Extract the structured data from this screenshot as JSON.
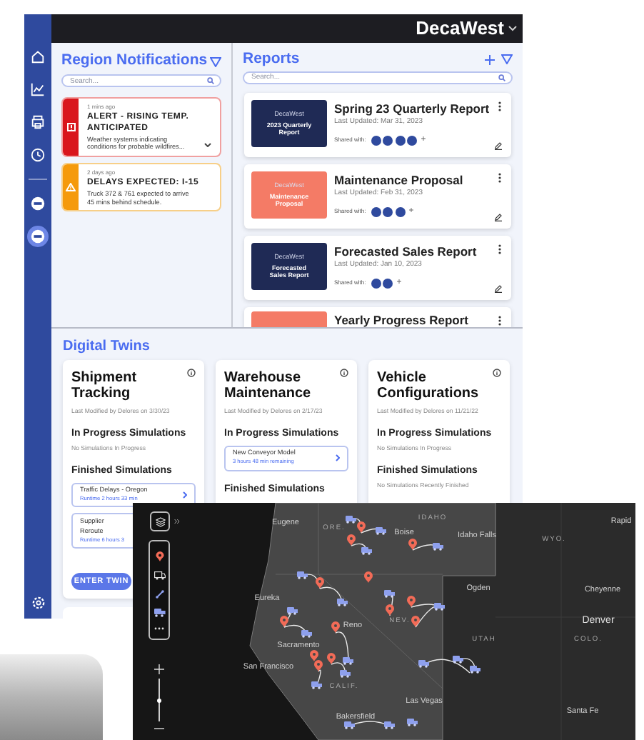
{
  "app_bar": {
    "brand": "DecaWest"
  },
  "sidebar": {
    "nav_items": [
      {
        "selected": false
      },
      {
        "selected": false
      },
      {
        "selected": false
      },
      {
        "selected": false
      },
      {
        "selected": false
      },
      {
        "selected": true
      }
    ]
  },
  "notifications": {
    "title": "Region Notifications",
    "search": {
      "placeholder": "Search..."
    },
    "items": [
      {
        "kind": "alert",
        "time": "1 mins ago",
        "title": "ALERT - RISING TEMP. ANTICIPATED",
        "body": "Weather systems indicating conditions for probable wildfires...",
        "expanded": false
      },
      {
        "kind": "warning",
        "time": "2 days ago",
        "title": "DELAYS EXPECTED: I-15",
        "body": "Truck 372 & 761 expected to arrive 45 mins behind schedule."
      }
    ]
  },
  "reports": {
    "title": "Reports",
    "search": {
      "placeholder": "Search..."
    },
    "items": [
      {
        "title": "Spring 23 Quarterly Report",
        "updated": "Last Updated: Mar 31, 2023",
        "thumb": {
          "color": "#1f2a55",
          "brand": "DecaWest",
          "title": "2023 Quarterly Report"
        },
        "shared_label": "Shared with:",
        "shared_with": [
          {
            "kind": "avatar"
          },
          {
            "kind": "avatar"
          },
          {
            "kind": "avatar"
          },
          {
            "kind": "avatar"
          }
        ],
        "more": "+"
      },
      {
        "title": "Maintenance Proposal",
        "updated": "Last Updated: Feb 31, 2023",
        "thumb": {
          "color": "#f47b66",
          "brand": "DecaWest",
          "title": "Maintenance Proposal"
        },
        "shared_label": "Shared with:",
        "shared_with": [
          {
            "kind": "avatar"
          },
          {
            "kind": "avatar"
          },
          {
            "kind": "avatar"
          }
        ],
        "more": "+"
      },
      {
        "title": "Forecasted Sales Report",
        "updated": "Last Updated: Jan 10, 2023",
        "thumb": {
          "color": "#1f2a55",
          "brand": "DecaWest",
          "title": "Forecasted Sales Report"
        },
        "shared_label": "Shared with:",
        "shared_with": [
          {
            "kind": "avatar"
          },
          {
            "kind": "avatar"
          }
        ],
        "more": "+"
      },
      {
        "title": "Yearly Progress Report",
        "thumb": {
          "color": "#f47b66"
        }
      }
    ]
  },
  "digital_twins": {
    "title": "Digital Twins",
    "cards": [
      {
        "title": "Shipment Tracking",
        "modified": "Last Modified by Delores on 3/30/23",
        "in_progress": {
          "heading": "In Progress Simulations",
          "empty_text": "No Simulations In Progress"
        },
        "finished": {
          "heading": "Finished Simulations",
          "items": [
            {
              "name": "Traffic Delays - Oregon",
              "detail": "Runtime 2 hours 33 min"
            },
            {
              "name": "Supplier Reroute",
              "detail": "Runtime 6 hours 3"
            }
          ]
        },
        "button": "ENTER TWIN"
      },
      {
        "title": "Warehouse Maintenance",
        "modified": "Last Modified by Delores on 2/17/23",
        "in_progress": {
          "heading": "In Progress Simulations",
          "items": [
            {
              "name": "New Conveyor Model",
              "detail": "3 hours 48 min remaining"
            }
          ]
        },
        "finished": {
          "heading": "Finished Simulations"
        }
      },
      {
        "title": "Vehicle Configurations",
        "modified": "Last Modified by Delores on 11/21/22",
        "in_progress": {
          "heading": "In Progress Simulations",
          "empty_text": "No Simulations In Progress"
        },
        "finished": {
          "heading": "Finished Simulations",
          "empty_text": "No Simulations Recently Finished"
        }
      }
    ]
  },
  "map": {
    "zoom": {
      "level": 0.5
    },
    "labels": [
      {
        "kind": "city",
        "text": "Eugene"
      },
      {
        "kind": "region",
        "text": "ORE."
      },
      {
        "kind": "region",
        "text": "IDAHO"
      },
      {
        "kind": "city",
        "text": "Boise"
      },
      {
        "kind": "city",
        "text": "Idaho Falls"
      },
      {
        "kind": "region",
        "text": "WYO."
      },
      {
        "kind": "city",
        "text": "Rapid"
      },
      {
        "kind": "city",
        "text": "Ogden"
      },
      {
        "kind": "city",
        "text": "Cheyenne"
      },
      {
        "kind": "city",
        "text": "Eureka"
      },
      {
        "kind": "region",
        "text": "NEV."
      },
      {
        "kind": "city",
        "text": "Reno"
      },
      {
        "kind": "capital",
        "text": "Denver"
      },
      {
        "kind": "region",
        "text": "UTAH"
      },
      {
        "kind": "region",
        "text": "COLO."
      },
      {
        "kind": "city",
        "text": "Sacramento"
      },
      {
        "kind": "city",
        "text": "San Francisco"
      },
      {
        "kind": "region",
        "text": "CALIF."
      },
      {
        "kind": "city",
        "text": "Las Vegas"
      },
      {
        "kind": "city",
        "text": "Santa Fe"
      },
      {
        "kind": "city",
        "text": "Bakersfield"
      }
    ]
  }
}
